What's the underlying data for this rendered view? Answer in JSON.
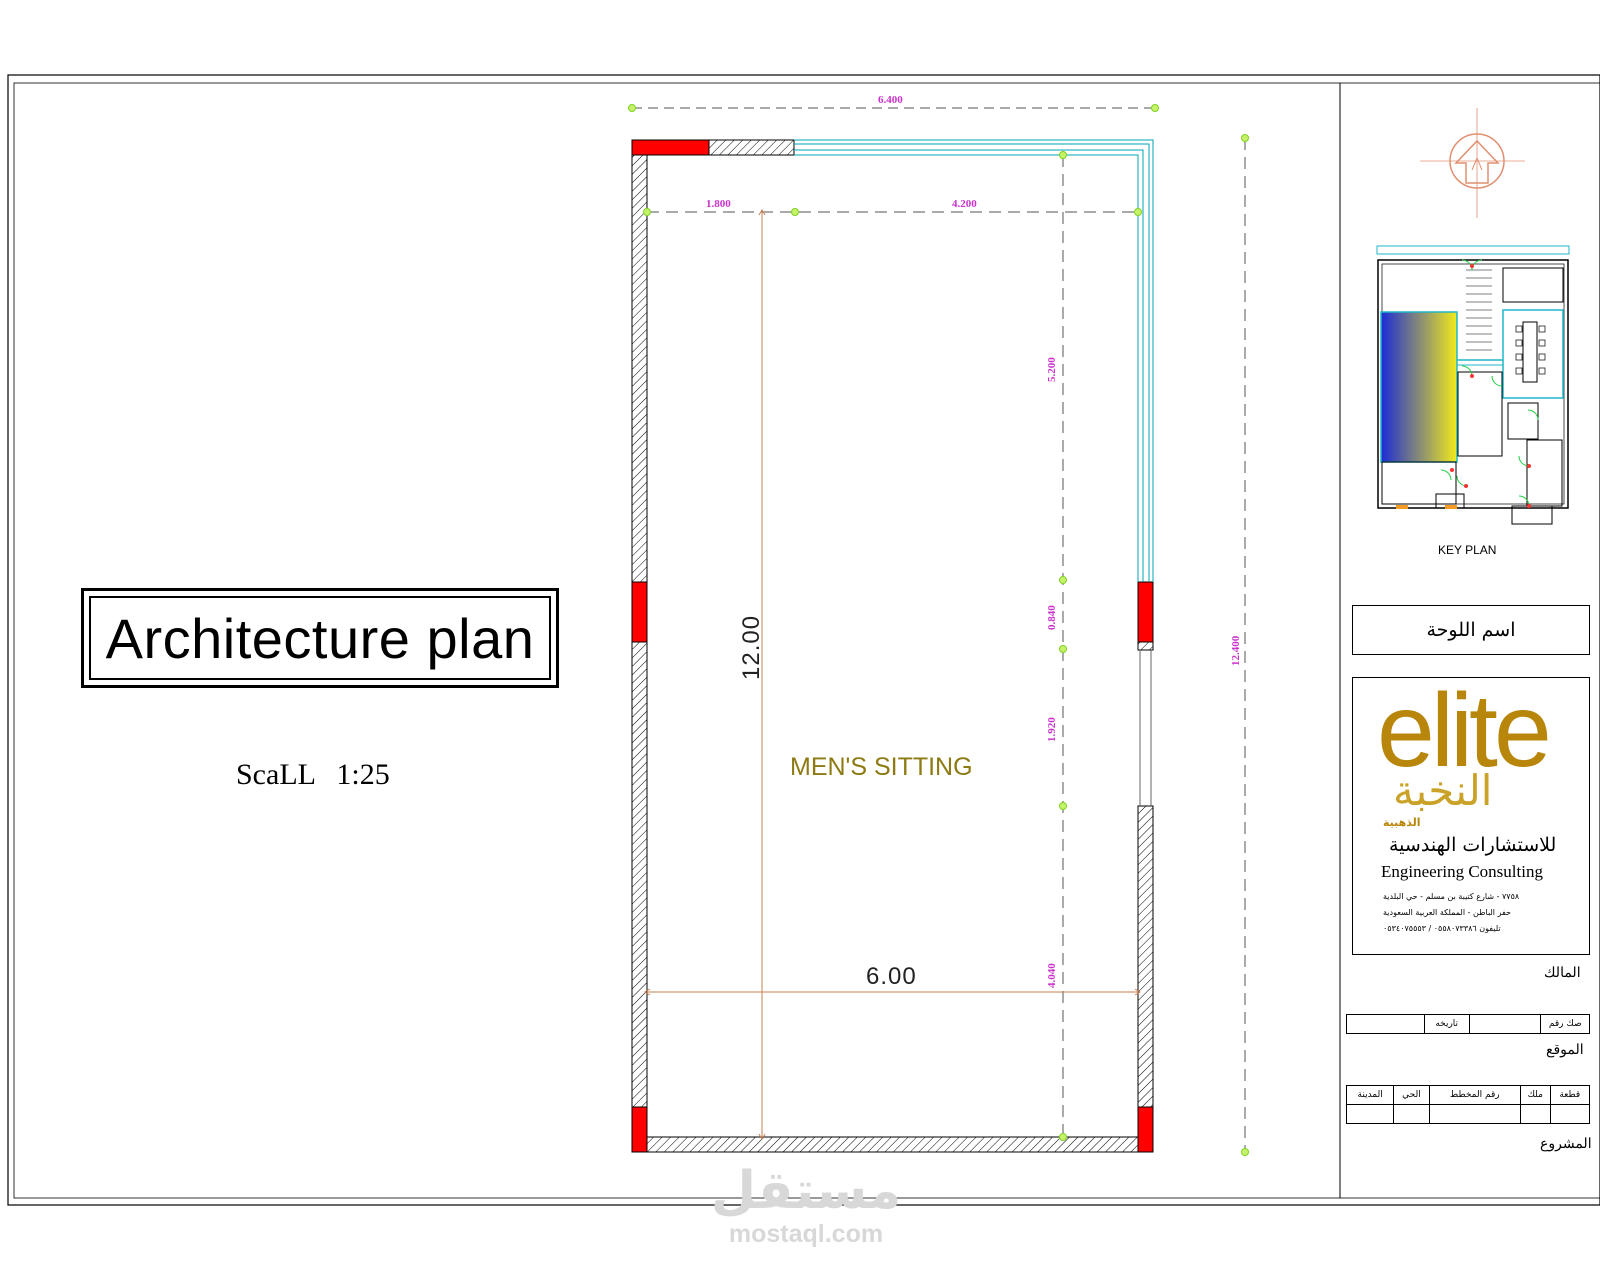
{
  "title": "Architecture plan",
  "scale_text": "ScaLL   1:25",
  "room": {
    "name": "MEN'S SITTING"
  },
  "dimensions": {
    "overall_width": "6.400",
    "segment_left": "1.800",
    "segment_right": "4.200",
    "interior_length": "12.00",
    "interior_width": "6.00",
    "overall_length": "12.400",
    "right_wall_segments": [
      "5.200",
      "0.840",
      "1.920",
      "4.040"
    ]
  },
  "key_plan_label": "KEY PLAN",
  "board_name_label": "اسم اللوحة",
  "logo": {
    "word": "elite",
    "arabic_name": "النخبة",
    "arabic_sub": "الذهبية",
    "consulting_ar": "للاستشارات الهندسية",
    "consulting_en": "Engineering Consulting",
    "address_line1": "٧٧٥٨ - شارع كتيبة بن مسلم - حي البلدية",
    "address_line2": "حفر الباطن - المملكة العربية السعودية",
    "phone_line": "تليفون ٠٥٥٨٠٧٣٣٨٦ / ٠٥٣٤٠٧٥٥٥٣"
  },
  "title_block": {
    "owner_label": "المالك",
    "deed_label": "صك رقم",
    "date_label": "تاريخه",
    "site_label": "الموقع",
    "site_columns": [
      "قطعة",
      "ملك",
      "رقم المخطط",
      "الحي",
      "المدينة"
    ],
    "project_label": "المشروع"
  },
  "watermark": {
    "arabic": "مستقل",
    "latin": "mostaql.com"
  },
  "colors": {
    "wall_hatch": "#000000",
    "column_fill": "#ff0000",
    "window_lines": "#00a6b5",
    "dim_text": "#cc33cc",
    "dim_line": "#c87f4f",
    "grid_node": "#7fd321",
    "room_label": "#8d7a12",
    "logo_gold": "#b8860b"
  }
}
